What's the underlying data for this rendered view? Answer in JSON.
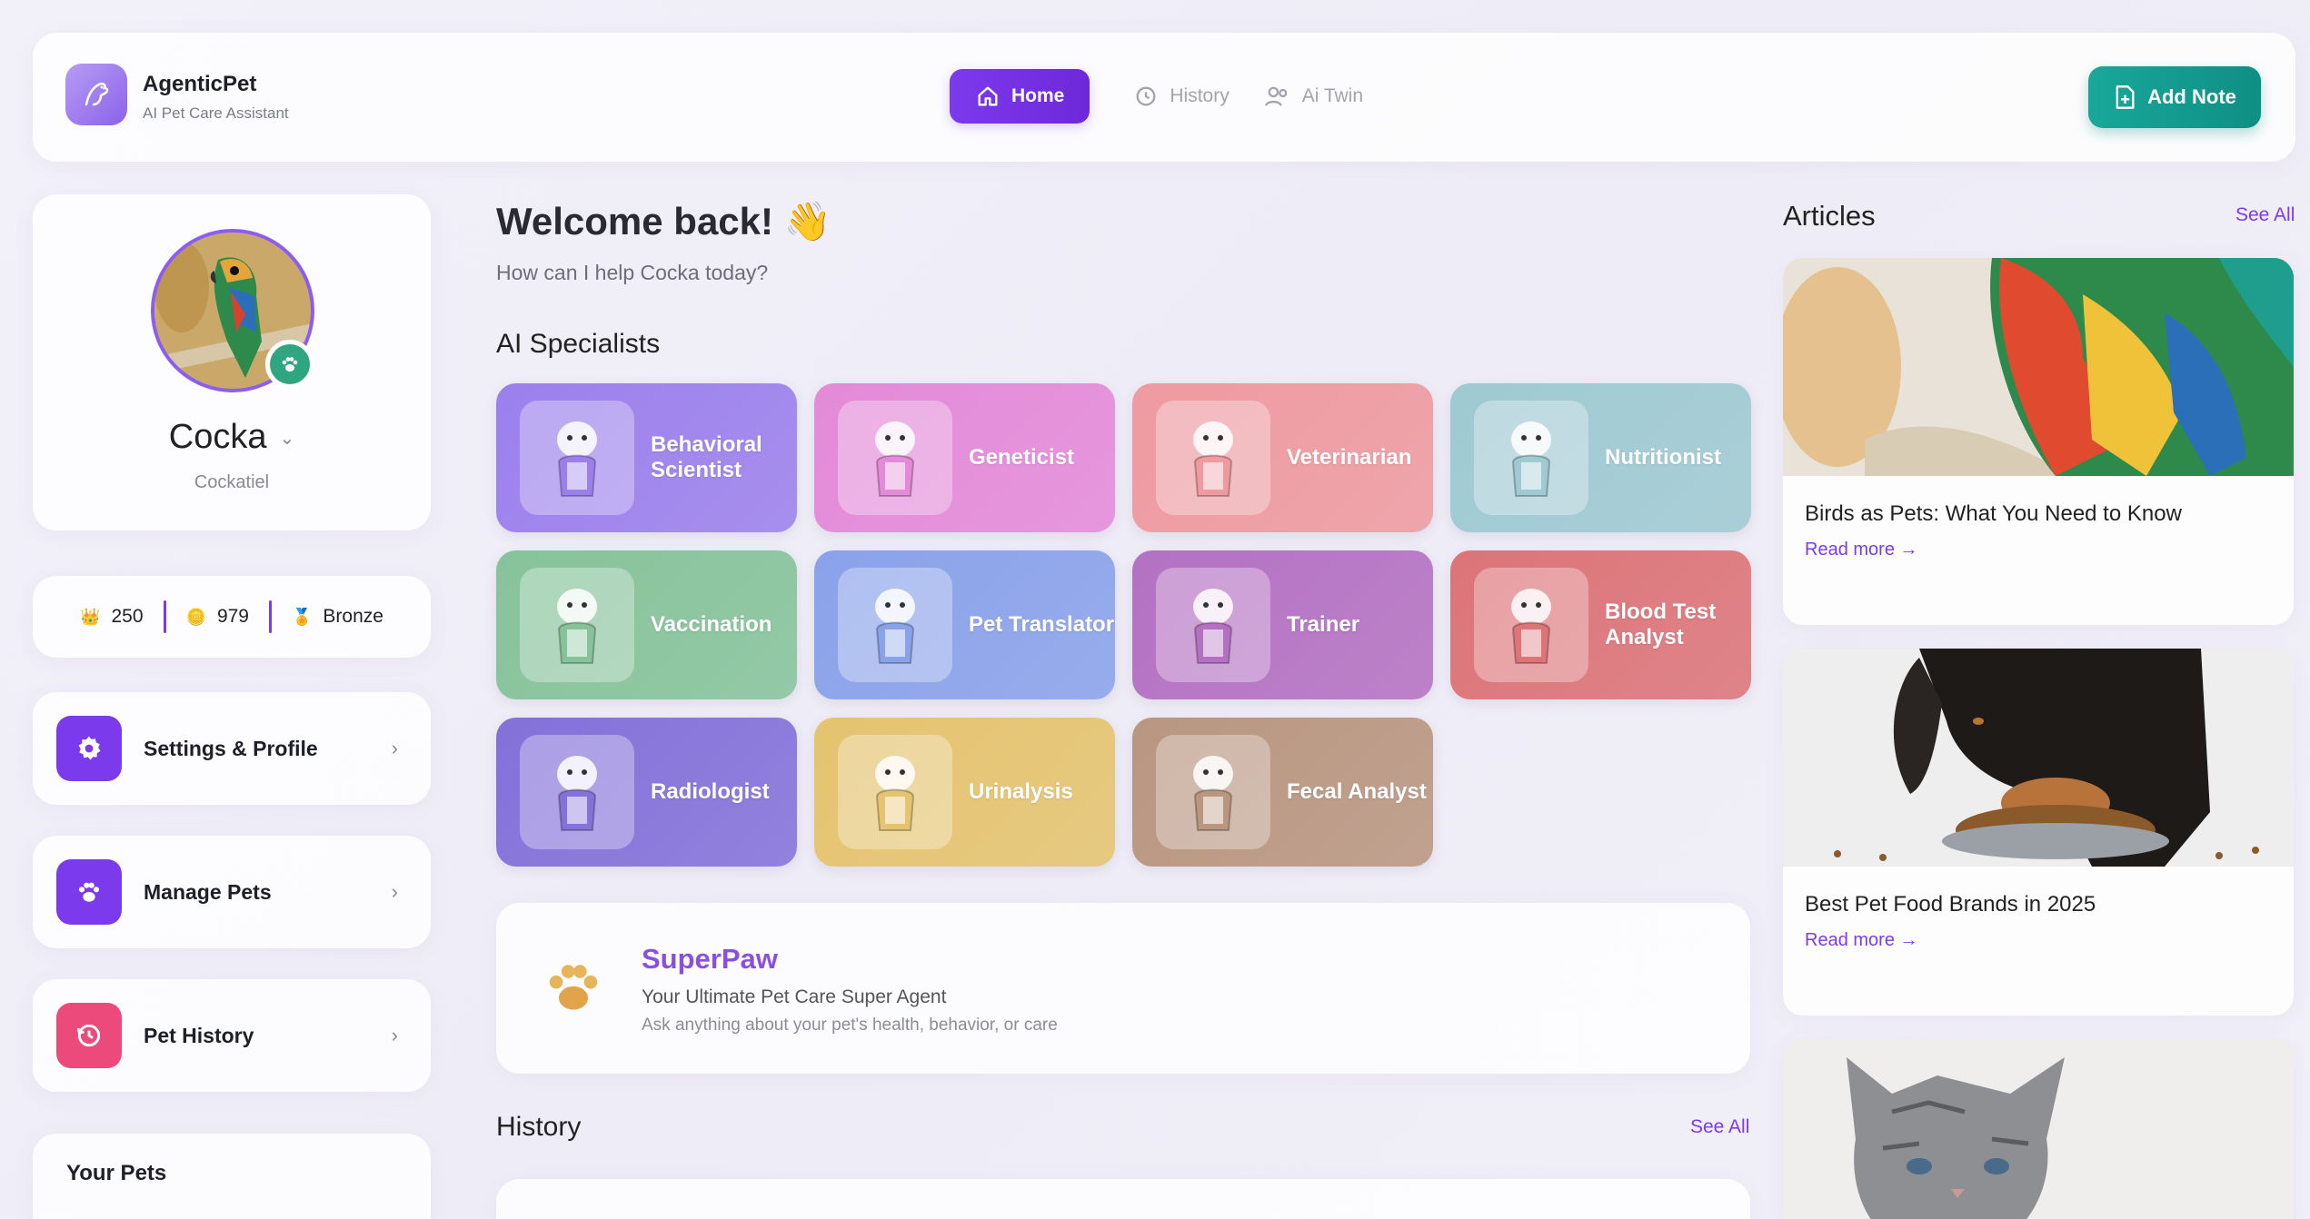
{
  "header": {
    "app_name": "AgenticPet",
    "app_subtitle": "AI Pet Care Assistant",
    "nav": [
      {
        "label": "Home",
        "icon": "home-icon",
        "active": true
      },
      {
        "label": "History",
        "icon": "history-icon",
        "active": false
      },
      {
        "label": "Ai Twin",
        "icon": "users-icon",
        "active": false
      }
    ],
    "add_note_label": "Add Note"
  },
  "profile": {
    "pet_name": "Cocka",
    "pet_breed": "Cockatiel",
    "badge_icon": "paw-icon"
  },
  "stats": [
    {
      "icon": "crown-icon",
      "value": "250"
    },
    {
      "icon": "coin-icon",
      "value": "979"
    },
    {
      "icon": "medal-icon",
      "value": "Bronze"
    }
  ],
  "menu": [
    {
      "label": "Settings & Profile",
      "icon": "gear-icon",
      "color": "#7c3aed"
    },
    {
      "label": "Manage Pets",
      "icon": "paw-icon",
      "color": "#7c3aed"
    },
    {
      "label": "Pet History",
      "icon": "history-icon",
      "color": "#ec4a7a"
    }
  ],
  "your_pets_title": "Your Pets",
  "main": {
    "welcome": "Welcome back! 👋",
    "help_text": "How can I help Cocka today?",
    "specialists_title": "AI Specialists",
    "specialists": [
      {
        "label": "Behavioral Scientist",
        "color": "#9b80ec"
      },
      {
        "label": "Geneticist",
        "color": "#e48ad8"
      },
      {
        "label": "Veterinarian",
        "color": "#ee9aa0"
      },
      {
        "label": "Nutritionist",
        "color": "#9fcad2"
      },
      {
        "label": "Vaccination",
        "color": "#86c39a"
      },
      {
        "label": "Pet Translator",
        "color": "#8aa2ea"
      },
      {
        "label": "Trainer",
        "color": "#b471c2"
      },
      {
        "label": "Blood Test Analyst",
        "color": "#dc7478"
      },
      {
        "label": "Radiologist",
        "color": "#8471d9"
      },
      {
        "label": "Urinalysis",
        "color": "#e5c46f"
      },
      {
        "label": "Fecal Analyst",
        "color": "#b99680"
      }
    ],
    "superpaw": {
      "title": "SuperPaw",
      "subtitle": "Your Ultimate Pet Care Super Agent",
      "hint": "Ask anything about your pet's health, behavior, or care"
    },
    "history_title": "History",
    "history_see_all": "See All"
  },
  "articles": {
    "title": "Articles",
    "see_all": "See All",
    "items": [
      {
        "title": "Birds as Pets: What You Need to Know",
        "read_more": "Read more"
      },
      {
        "title": "Best Pet Food Brands in 2025",
        "read_more": "Read more"
      },
      {
        "title": "",
        "read_more": ""
      }
    ]
  }
}
